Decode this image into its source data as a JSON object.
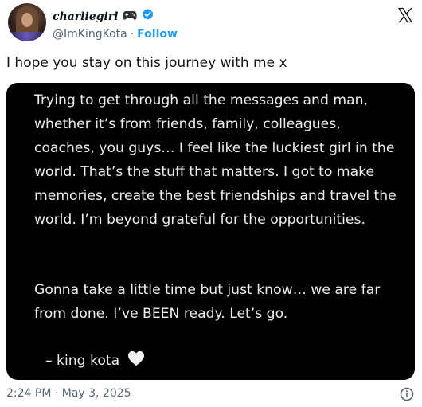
{
  "user": {
    "display_name": "charliegirl",
    "handle": "@ImKingKota",
    "separator": "·",
    "follow_label": "Follow"
  },
  "tweet": {
    "text": "I hope you stay on this journey with me x",
    "timestamp": "2:24 PM · May 3, 2025"
  },
  "media": {
    "paragraph_1": "Trying to get through all the messages and man, whether it’s from friends, family, colleagues, coaches, you guys… I feel like the luckiest girl in the world. That’s the stuff that matters. I got to make memories, create the best friendships and travel the world. I’m beyond grateful for the opportunities.",
    "paragraph_2": "Gonna take a little time but just know… we are far from done. I’ve BEEN ready. Let’s go.",
    "signature": "–   king kota"
  },
  "icons": {
    "avatar": "profile-photo",
    "badge_emoji": "game-controller-icon",
    "verified": "verified-badge-icon",
    "platform": "x-logo-icon",
    "signature_emoji": "white-heart-icon",
    "info": "info-icon"
  },
  "colors": {
    "link": "#1d9bf0",
    "secondary_text": "#536471",
    "card_background": "#000000",
    "card_text": "#ededed"
  }
}
